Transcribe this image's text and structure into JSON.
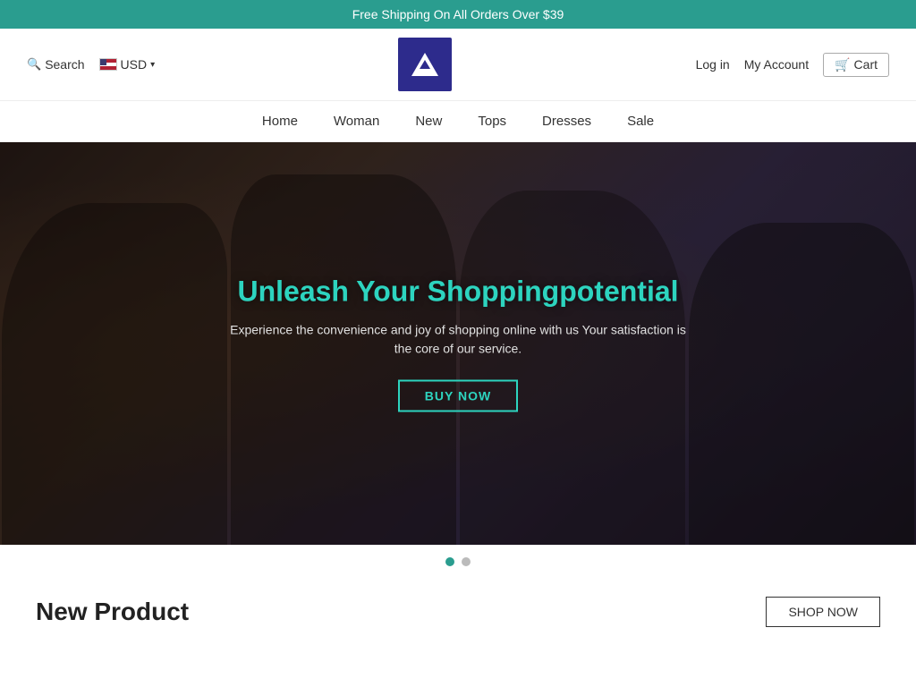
{
  "banner": {
    "text": "Free Shipping On All Orders Over $39"
  },
  "header": {
    "search_label": "Search",
    "currency": "USD",
    "log_in": "Log in",
    "my_account": "My Account",
    "cart": "Cart"
  },
  "nav": {
    "items": [
      {
        "label": "Home",
        "id": "home"
      },
      {
        "label": "Woman",
        "id": "woman"
      },
      {
        "label": "New",
        "id": "new"
      },
      {
        "label": "Tops",
        "id": "tops"
      },
      {
        "label": "Dresses",
        "id": "dresses"
      },
      {
        "label": "Sale",
        "id": "sale"
      }
    ]
  },
  "hero": {
    "title": "Unleash Your Shoppingpotential",
    "subtitle": "Experience the convenience and joy of shopping online with us Your satisfaction is the core of our service.",
    "cta_label": "BUY NOW"
  },
  "dots": [
    {
      "active": true
    },
    {
      "active": false
    }
  ],
  "bottom": {
    "new_product_title": "New Product",
    "shop_now": "SHOP NOW"
  }
}
